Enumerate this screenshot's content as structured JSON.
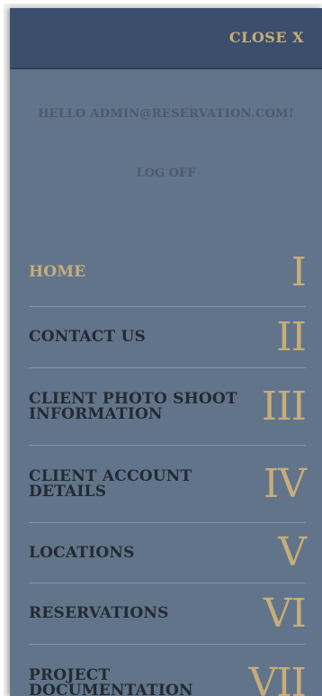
{
  "header": {
    "close_label": "CLOSE X"
  },
  "account": {
    "greeting": "HELLO ADMIN@RESERVATION.COM!",
    "logoff_label": "LOG OFF"
  },
  "colors": {
    "panel": "#627489",
    "topbar": "#3b4f6c",
    "accent": "#c7ad7b",
    "text_dark": "#222a33"
  },
  "menu": {
    "items": [
      {
        "label": "HOME",
        "numeral": "I",
        "active": true
      },
      {
        "label": "CONTACT US",
        "numeral": "II",
        "active": false
      },
      {
        "label": "CLIENT PHOTO SHOOT INFORMATION",
        "numeral": "III",
        "active": false
      },
      {
        "label": "CLIENT ACCOUNT DETAILS",
        "numeral": "IV",
        "active": false
      },
      {
        "label": "LOCATIONS",
        "numeral": "V",
        "active": false
      },
      {
        "label": "RESERVATIONS",
        "numeral": "VI",
        "active": false
      },
      {
        "label": "PROJECT DOCUMENTATION",
        "numeral": "VII",
        "active": false
      }
    ]
  }
}
